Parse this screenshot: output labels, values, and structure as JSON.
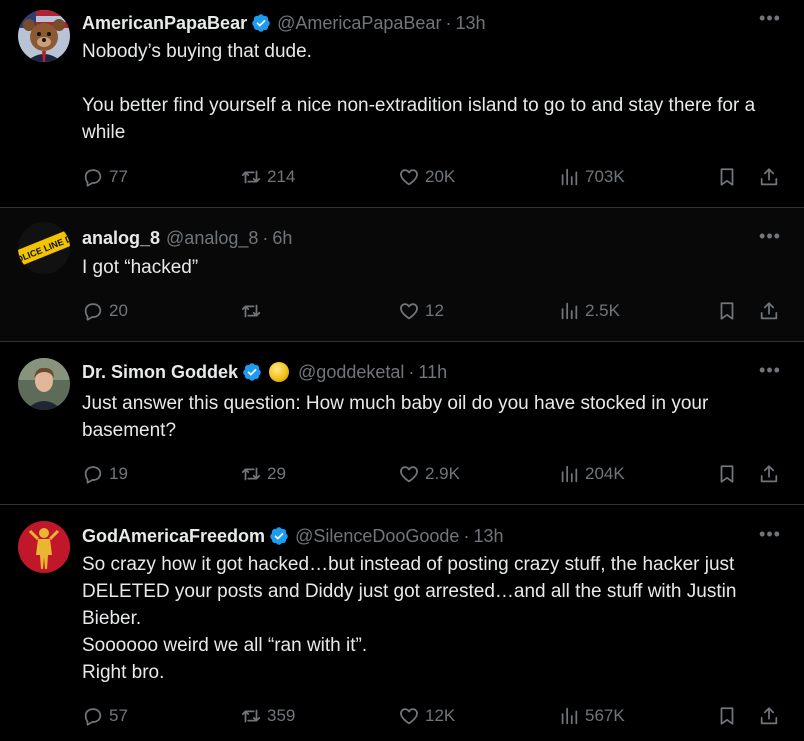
{
  "tweets": [
    {
      "name": "AmericanPapaBear",
      "verified": true,
      "handle": "@AmericaPapaBear",
      "time": "13h",
      "text": "Nobody’s buying that dude.\n\nYou better find yourself a nice non-extradition island to go to and stay there for a while",
      "replies": "77",
      "retweets": "214",
      "likes": "20K",
      "views": "703K"
    },
    {
      "name": "analog_8",
      "verified": false,
      "handle": "@analog_8",
      "time": "6h",
      "text": "I got “hacked”",
      "replies": "20",
      "retweets": "",
      "likes": "12",
      "views": "2.5K",
      "avatar_text": "POLICE LINE DO"
    },
    {
      "name": "Dr. Simon Goddek",
      "verified": true,
      "handle": "@goddeketal",
      "time": "11h",
      "text": "Just answer this question: How much baby oil do you have stocked in your basement?",
      "replies": "19",
      "retweets": "29",
      "likes": "2.9K",
      "views": "204K"
    },
    {
      "name": "GodAmericaFreedom",
      "verified": true,
      "handle": "@SilenceDooGoode",
      "time": "13h",
      "text": "So crazy how it got hacked…but instead of posting crazy stuff, the hacker just DELETED your posts and Diddy just got arrested…and all the stuff with Justin Bieber.\nSoooooo weird we all “ran with it”.\nRight bro.",
      "replies": "57",
      "retweets": "359",
      "likes": "12K",
      "views": "567K"
    }
  ],
  "ui": {
    "separator": "·",
    "more": "•••"
  },
  "colors": {
    "verified": "#1d9bf0",
    "muted": "#71767b",
    "text": "#e7e9ea",
    "border": "#2f3336"
  }
}
